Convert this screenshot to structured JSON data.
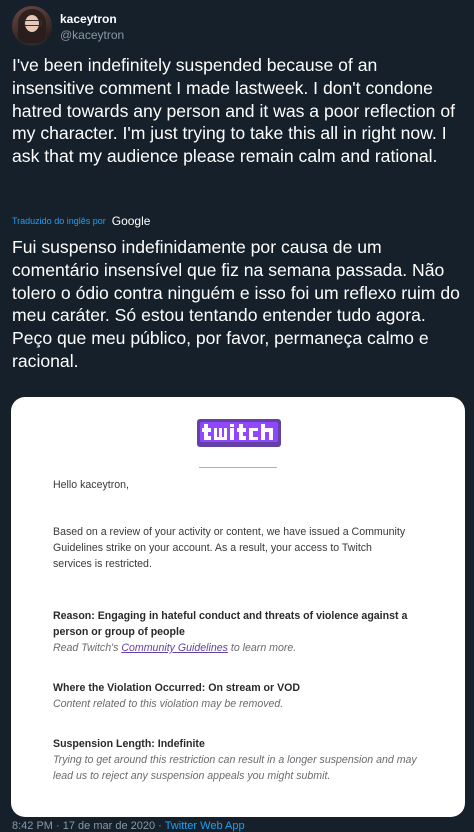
{
  "author": {
    "display_name": "kaceytron",
    "handle": "@kaceytron"
  },
  "tweet": {
    "text": "I've been indefinitely suspended because of an insensitive comment I made lastweek. I don't condone hatred towards any person and it was a poor reflection of my character. I'm just trying to take this all in right now. I ask that my audience please remain calm and rational.",
    "translated_by_label": "Traduzido do inglês por",
    "translator": "Google",
    "translation": "Fui suspenso indefinidamente por causa de um comentário insensível que fiz na semana passada. Não tolero o ódio contra ninguém e isso foi um reflexo ruim do meu caráter. Só estou tentando entender tudo agora. Peço que meu público, por favor, permaneça calmo e racional."
  },
  "media": {
    "brand": "twitch",
    "email": {
      "greeting": "Hello kaceytron,",
      "body": "Based on a review of your activity or content, we have issued a Community Guidelines strike on your account. As a result, your access to Twitch services is restricted.",
      "reason_label": "Reason: Engaging in hateful conduct and threats of violence against a person or group of people",
      "reason_note_prefix": "Read Twitch's ",
      "reason_note_link": "Community Guidelines",
      "reason_note_suffix": " to learn more.",
      "where_label": "Where the Violation Occurred: On stream or VOD",
      "where_note": "Content related to this violation may be removed.",
      "length_label": "Suspension Length: Indefinite",
      "length_note": "Trying to get around this restriction can result in a longer suspension and may lead us to reject any suspension appeals you might submit."
    }
  },
  "footer": {
    "time": "8:42 PM",
    "sep1": " · ",
    "date": "17 de mar de 2020",
    "sep2": " · ",
    "source": "Twitter Web App"
  },
  "colors": {
    "background": "#15202b",
    "accent": "#1da1f2",
    "twitch_purple": "#9146ff"
  }
}
